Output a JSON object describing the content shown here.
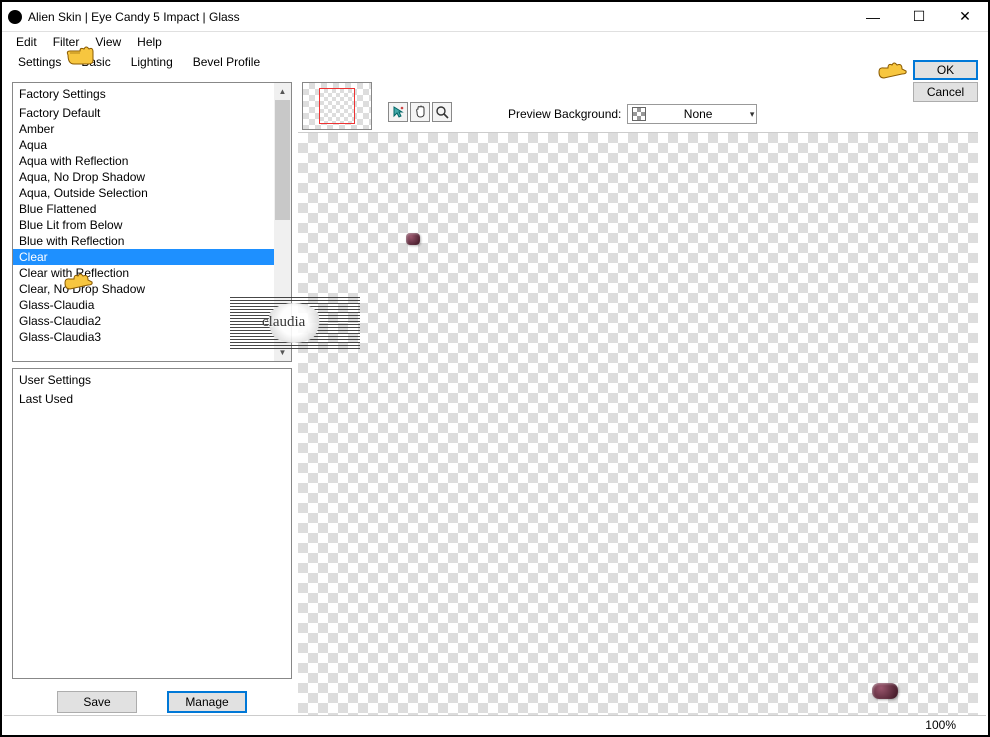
{
  "window": {
    "title": "Alien Skin | Eye Candy 5 Impact | Glass",
    "controls": {
      "minimize": "—",
      "maximize": "☐",
      "close": "✕"
    }
  },
  "menu": {
    "items": [
      "Edit",
      "Filter",
      "View",
      "Help"
    ]
  },
  "tabs": {
    "items": [
      "Settings",
      "Basic",
      "Lighting",
      "Bevel Profile"
    ]
  },
  "factory": {
    "header": "Factory Settings",
    "items": [
      "Factory Default",
      "Amber",
      "Aqua",
      "Aqua with Reflection",
      "Aqua, No Drop Shadow",
      "Aqua, Outside Selection",
      "Blue Flattened",
      "Blue Lit from Below",
      "Blue with Reflection",
      "Clear",
      "Clear with Reflection",
      "Clear, No Drop Shadow",
      "Glass-Claudia",
      "Glass-Claudia2",
      "Glass-Claudia3"
    ],
    "selected_index": 9
  },
  "user": {
    "header": "User Settings",
    "items": [
      "Last Used"
    ]
  },
  "buttons": {
    "save": "Save",
    "manage": "Manage"
  },
  "preview_bg": {
    "label": "Preview Background:",
    "value": "None"
  },
  "dialog": {
    "ok": "OK",
    "cancel": "Cancel"
  },
  "status": {
    "zoom": "100%"
  },
  "watermark": {
    "text": "claudia"
  }
}
